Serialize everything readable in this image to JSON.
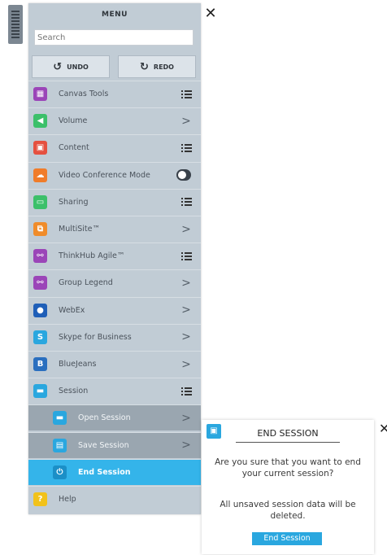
{
  "menu": {
    "title": "MENU",
    "close": "✕",
    "search_placeholder": "Search",
    "undo_label": "UNDO",
    "redo_label": "REDO",
    "items": [
      {
        "label": "Canvas Tools",
        "icon": "canvas-tools-icon",
        "color": "#9b45b8",
        "right": "list"
      },
      {
        "label": "Volume",
        "icon": "volume-icon",
        "color": "#3cc06a",
        "right": "chevron"
      },
      {
        "label": "Content",
        "icon": "content-icon",
        "color": "#e5503f",
        "right": "list"
      },
      {
        "label": "Video Conference Mode",
        "icon": "video-conference-icon",
        "color": "#f07c2a",
        "right": "toggle",
        "toggle_on": false
      },
      {
        "label": "Sharing",
        "icon": "sharing-icon",
        "color": "#3cc06a",
        "right": "list"
      },
      {
        "label": "MultiSite™",
        "icon": "multisite-icon",
        "color": "#f08c2a",
        "right": "chevron"
      },
      {
        "label": "ThinkHub Agile™",
        "icon": "thinkhub-agile-icon",
        "color": "#9b45b8",
        "right": "list"
      },
      {
        "label": "Group Legend",
        "icon": "group-legend-icon",
        "color": "#9b45b8",
        "right": "chevron"
      },
      {
        "label": "WebEx",
        "icon": "webex-icon",
        "color": "#1f5fb8",
        "right": "chevron"
      },
      {
        "label": "Skype for Business",
        "icon": "skype-icon",
        "color": "#2aa7df",
        "right": "chevron"
      },
      {
        "label": "BlueJeans",
        "icon": "bluejeans-icon",
        "color": "#2a6fbf",
        "right": "chevron"
      },
      {
        "label": "Session",
        "icon": "session-icon",
        "color": "#2aa7df",
        "right": "list"
      }
    ],
    "session_items": [
      {
        "label": "Open Session",
        "icon": "open-session-icon",
        "color": "#2aa7df"
      },
      {
        "label": "Save Session",
        "icon": "save-session-icon",
        "color": "#2aa7df"
      }
    ],
    "end_session": {
      "label": "End Session",
      "icon": "power-icon",
      "color": "#1b8fc7"
    },
    "help": {
      "label": "Help",
      "icon": "help-icon",
      "color": "#f2c21a"
    }
  },
  "dialog": {
    "title": "END SESSION",
    "question": "Are you sure that you want to end your current session?",
    "warning": "All unsaved session data will be deleted.",
    "button": "End Session",
    "close": "✕"
  }
}
